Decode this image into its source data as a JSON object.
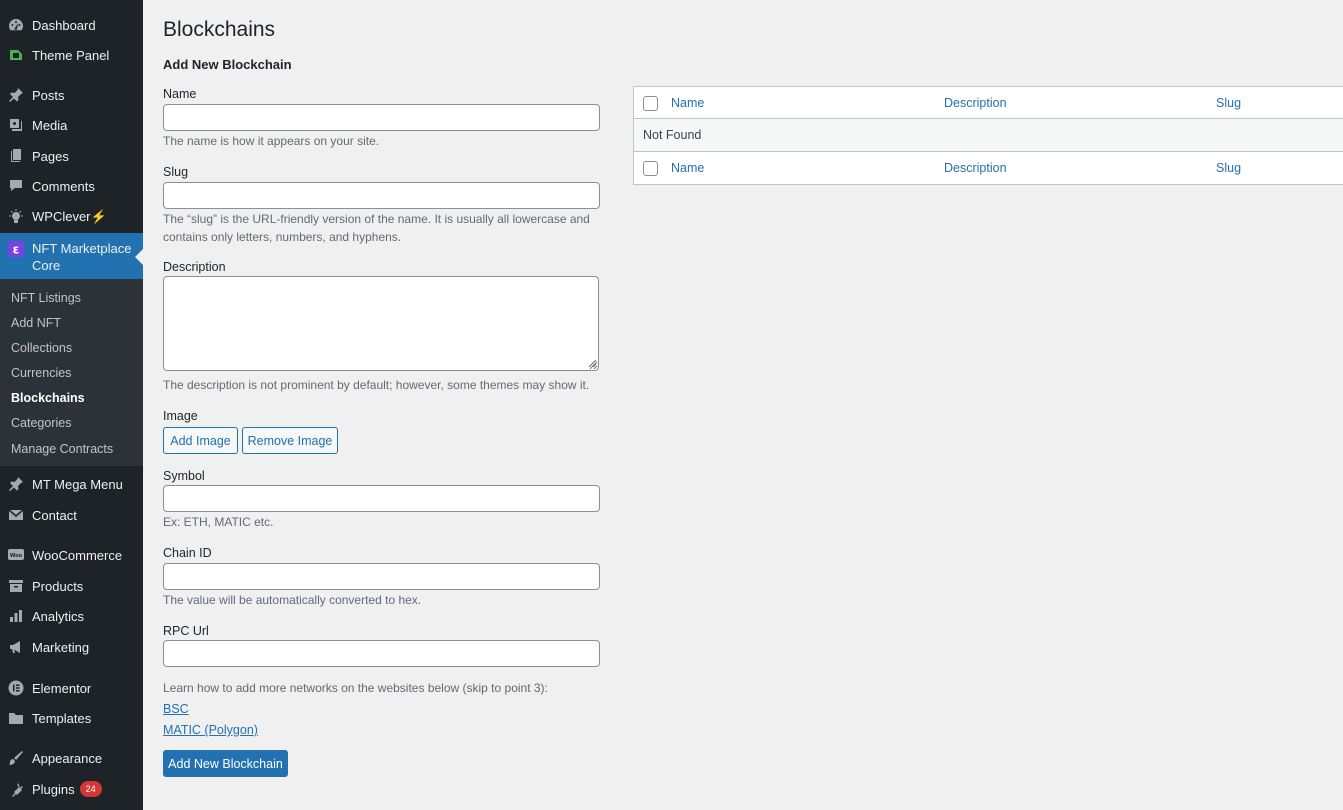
{
  "sidebar": {
    "items": [
      {
        "label": "Dashboard",
        "icon": "dashboard-icon"
      },
      {
        "label": "Theme Panel",
        "icon": "theme-panel-icon"
      },
      {
        "label": "Posts",
        "icon": "pin-icon"
      },
      {
        "label": "Media",
        "icon": "media-icon"
      },
      {
        "label": "Pages",
        "icon": "pages-icon"
      },
      {
        "label": "Comments",
        "icon": "comment-icon"
      },
      {
        "label": "WPClever",
        "bolt": "⚡",
        "icon": "lightbulb-icon"
      },
      {
        "label": "NFT Marketplace Core",
        "icon": "nft-core-icon"
      },
      {
        "label": "MT Mega Menu",
        "icon": "pin-icon"
      },
      {
        "label": "Contact",
        "icon": "mail-icon"
      },
      {
        "label": "WooCommerce",
        "icon": "woocommerce-icon"
      },
      {
        "label": "Products",
        "icon": "archive-icon"
      },
      {
        "label": "Analytics",
        "icon": "bar-chart-icon"
      },
      {
        "label": "Marketing",
        "icon": "megaphone-icon"
      },
      {
        "label": "Elementor",
        "icon": "elementor-icon"
      },
      {
        "label": "Templates",
        "icon": "folder-icon"
      },
      {
        "label": "Appearance",
        "icon": "brush-icon"
      },
      {
        "label": "Plugins",
        "icon": "plugin-icon",
        "badge": "24"
      }
    ],
    "submenu": [
      {
        "label": "NFT Listings"
      },
      {
        "label": "Add NFT"
      },
      {
        "label": "Collections"
      },
      {
        "label": "Currencies"
      },
      {
        "label": "Blockchains"
      },
      {
        "label": "Categories"
      },
      {
        "label": "Manage Contracts"
      }
    ]
  },
  "page": {
    "title": "Blockchains",
    "form_title": "Add New Blockchain"
  },
  "form": {
    "name": {
      "label": "Name",
      "value": "",
      "help": "The name is how it appears on your site."
    },
    "slug": {
      "label": "Slug",
      "value": "",
      "help": "The “slug” is the URL-friendly version of the name. It is usually all lowercase and contains only letters, numbers, and hyphens."
    },
    "description": {
      "label": "Description",
      "value": "",
      "help": "The description is not prominent by default; however, some themes may show it."
    },
    "image": {
      "label": "Image",
      "add_button": "Add Image",
      "remove_button": "Remove Image"
    },
    "symbol": {
      "label": "Symbol",
      "value": "",
      "help": "Ex: ETH, MATIC etc."
    },
    "chain_id": {
      "label": "Chain ID",
      "value": "",
      "help": "The value will be automatically converted to hex."
    },
    "rpc_url": {
      "label": "RPC Url",
      "value": ""
    },
    "networks_note": "Learn how to add more networks on the websites below (skip to point 3):",
    "links": [
      {
        "label": "BSC"
      },
      {
        "label": "MATIC (Polygon)"
      }
    ],
    "submit_label": "Add New Blockchain"
  },
  "table": {
    "columns": [
      "Name",
      "Description",
      "Slug"
    ],
    "empty_text": "Not Found"
  },
  "colors": {
    "sidebar_bg": "#1d2327",
    "submenu_bg": "#2c3338",
    "accent": "#2271b1",
    "badge": "#d63638",
    "page_bg": "#f0f0f1"
  }
}
